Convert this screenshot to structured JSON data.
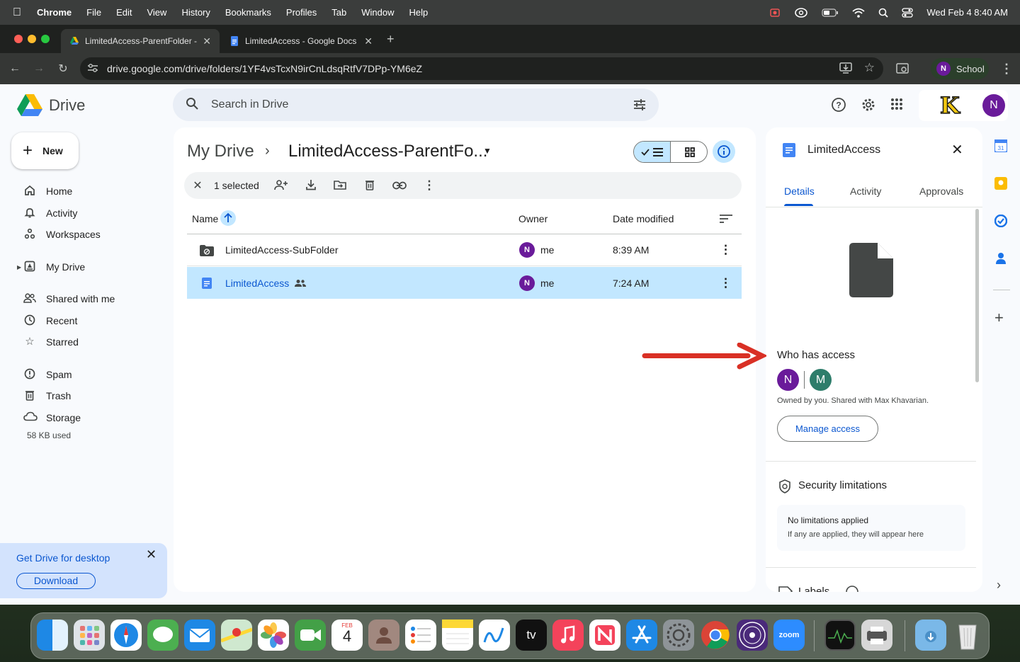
{
  "menubar": {
    "app_name": "Chrome",
    "items": [
      "File",
      "Edit",
      "View",
      "History",
      "Bookmarks",
      "Profiles",
      "Tab",
      "Window",
      "Help"
    ],
    "clock": "Wed Feb 4  8:40 AM"
  },
  "browser": {
    "tabs": [
      {
        "title": "LimitedAccess-ParentFolder -"
      },
      {
        "title": "LimitedAccess - Google Docs"
      }
    ],
    "url": "drive.google.com/drive/folders/1YF4vsTcxN9irCnLdsqRtfV7DPp-YM6eZ",
    "profile_initial": "N",
    "profile_name": "School"
  },
  "drive": {
    "product": "Drive",
    "search_placeholder": "Search in Drive",
    "account_initial": "N",
    "org_logo_letter": "K",
    "new_label": "New",
    "nav": [
      {
        "label": "Home",
        "icon": "home-icon"
      },
      {
        "label": "Activity",
        "icon": "bell-icon"
      },
      {
        "label": "Workspaces",
        "icon": "workspaces-icon"
      },
      {
        "label": "My Drive",
        "icon": "my-drive-icon"
      },
      {
        "label": "Shared with me",
        "icon": "people-icon"
      },
      {
        "label": "Recent",
        "icon": "clock-icon"
      },
      {
        "label": "Starred",
        "icon": "star-icon"
      },
      {
        "label": "Spam",
        "icon": "spam-icon"
      },
      {
        "label": "Trash",
        "icon": "trash-icon"
      },
      {
        "label": "Storage",
        "icon": "cloud-icon"
      }
    ],
    "storage_used": "58 KB used",
    "promo": {
      "title": "Get Drive for desktop",
      "button": "Download"
    },
    "breadcrumb": {
      "root": "My Drive",
      "current": "LimitedAccess-ParentFo..."
    },
    "selection": {
      "count_label": "1 selected"
    },
    "columns": {
      "name": "Name",
      "owner": "Owner",
      "modified": "Date modified"
    },
    "files": [
      {
        "name": "LimitedAccess-SubFolder",
        "owner_initial": "N",
        "owner": "me",
        "modified": "8:39 AM",
        "selected": false
      },
      {
        "name": "LimitedAccess",
        "owner_initial": "N",
        "owner": "me",
        "modified": "7:24 AM",
        "selected": true
      }
    ]
  },
  "details": {
    "title": "LimitedAccess",
    "tabs": [
      "Details",
      "Activity",
      "Approvals"
    ],
    "who_has_access": "Who has access",
    "access_avatars": [
      "N",
      "M"
    ],
    "owned_text": "Owned by you. Shared with Max Khavarian.",
    "manage_button": "Manage access",
    "security_title": "Security limitations",
    "no_limitations": "No limitations applied",
    "limitations_note": "If any are applied, they will appear here",
    "labels_title": "Labels"
  },
  "colors": {
    "accent": "#0b57d0",
    "selected_row": "#c2e7ff",
    "avatar_n": "#6a1b9a",
    "avatar_m": "#2e7d6b",
    "annotation_arrow": "#d93025"
  },
  "dock": {
    "calendar_month": "FEB",
    "calendar_day": "4",
    "tv_label": "tv",
    "zoom_label": "zoom"
  }
}
